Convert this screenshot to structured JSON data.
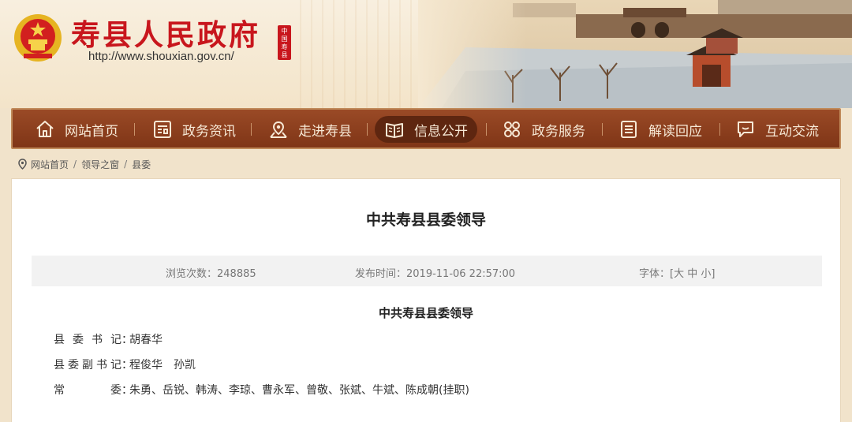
{
  "header": {
    "title": "寿县人民政府",
    "url": "http://www.shouxian.gov.cn/",
    "seal_text": "中国寿县",
    "photo_icon": "city-gate-photo"
  },
  "nav": {
    "items": [
      {
        "label": "网站首页",
        "icon": "home-icon"
      },
      {
        "label": "政务资讯",
        "icon": "news-icon"
      },
      {
        "label": "走进寿县",
        "icon": "map-pin-icon"
      },
      {
        "label": "信息公开",
        "icon": "book-icon",
        "active": true
      },
      {
        "label": "政务服务",
        "icon": "grid-icon"
      },
      {
        "label": "解读回应",
        "icon": "list-icon"
      },
      {
        "label": "互动交流",
        "icon": "chat-icon"
      }
    ]
  },
  "breadcrumb": {
    "items": [
      "网站首页",
      "领导之窗",
      "县委"
    ],
    "separator": "/"
  },
  "article": {
    "title": "中共寿县县委领导",
    "views": "浏览次数：248885",
    "published": "发布时间：2019-11-06 22:57:00",
    "font_size": "字体：[大 中 小]",
    "subtitle": "中共寿县县委领导",
    "rows": [
      {
        "label": "县委书记",
        "value": "胡春华"
      },
      {
        "label": "县委副书记",
        "value": "程俊华　孙凯"
      },
      {
        "label": "常委",
        "value": "朱勇、岳锐、韩涛、李琼、曹永军、曾敬、张斌、牛斌、陈成朝(挂职)"
      }
    ]
  },
  "colors": {
    "brand_red": "#c8161d",
    "nav_brown": "#8a3d1c",
    "page_beige": "#f1e3cb"
  }
}
